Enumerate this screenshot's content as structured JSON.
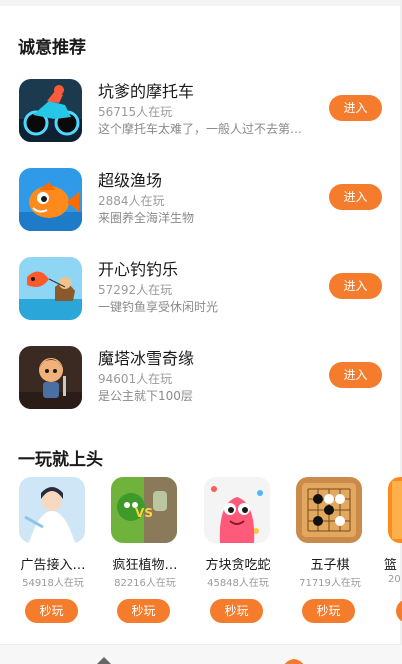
{
  "sections": {
    "recommend_title": "诚意推荐",
    "hot_title": "一玩就上头"
  },
  "recommend": [
    {
      "name": "坑爹的摩托车",
      "players": "56715人在玩",
      "desc": "这个摩托车太难了，一般人过不去第…",
      "button": "进入",
      "icon": "motorcycle-icon"
    },
    {
      "name": "超级渔场",
      "players": "2884人在玩",
      "desc": "来圈养全海洋生物",
      "button": "进入",
      "icon": "fish-icon"
    },
    {
      "name": "开心钓钓乐",
      "players": "57292人在玩",
      "desc": "一键钓鱼享受休闲时光",
      "button": "进入",
      "icon": "fishing-icon"
    },
    {
      "name": "魔塔冰雪奇缘",
      "players": "94601人在玩",
      "desc": "是公主就下100层",
      "button": "进入",
      "icon": "tower-icon"
    }
  ],
  "hot": [
    {
      "name": "广告接入…",
      "players": "54918人在玩",
      "button": "秒玩",
      "icon": "xianxia-icon"
    },
    {
      "name": "疯狂植物…",
      "players": "82216人在玩",
      "button": "秒玩",
      "icon": "plant-icon"
    },
    {
      "name": "方块贪吃蛇",
      "players": "45848人在玩",
      "button": "秒玩",
      "icon": "snake-icon"
    },
    {
      "name": "五子棋",
      "players": "71719人在玩",
      "button": "秒玩",
      "icon": "gomoku-icon"
    },
    {
      "name": "篮",
      "players": "20",
      "button": "",
      "icon": "basketball-icon"
    }
  ],
  "colors": {
    "accent": "#f47c2c"
  }
}
